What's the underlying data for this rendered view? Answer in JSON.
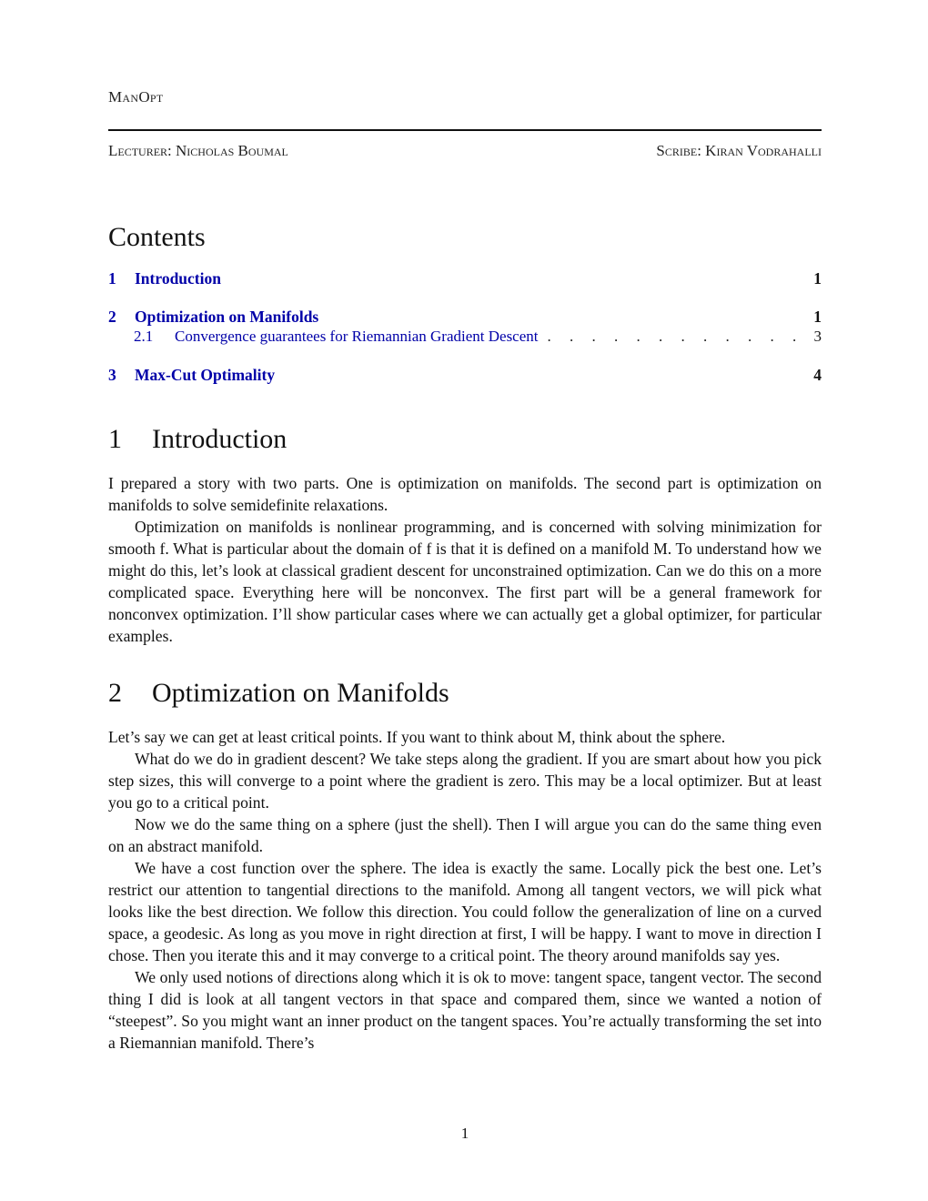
{
  "header": {
    "running_title": "ManOpt",
    "lecturer": "Lecturer: Nicholas Boumal",
    "scribe": "Scribe: Kiran Vodrahalli"
  },
  "toc": {
    "title": "Contents",
    "link_color": "#0000a8",
    "entries": [
      {
        "num": "1",
        "label": "Introduction",
        "page": "1",
        "level": 1
      },
      {
        "num": "2",
        "label": "Optimization on Manifolds",
        "page": "1",
        "level": 1
      },
      {
        "num": "2.1",
        "label": "Convergence guarantees for Riemannian Gradient Descent",
        "page": "3",
        "level": 2
      },
      {
        "num": "3",
        "label": "Max-Cut Optimality",
        "page": "4",
        "level": 1
      }
    ]
  },
  "sections": [
    {
      "num": "1",
      "title": "Introduction",
      "paragraphs": [
        "I prepared a story with two parts. One is optimization on manifolds. The second part is optimization on manifolds to solve semidefinite relaxations.",
        "Optimization on manifolds is nonlinear programming, and is concerned with solving minimization for smooth f. What is particular about the domain of f is that it is defined on a manifold M. To understand how we might do this, let’s look at classical gradient descent for unconstrained optimization. Can we do this on a more complicated space. Everything here will be nonconvex. The first part will be a general framework for nonconvex optimization. I’ll show particular cases where we can actually get a global optimizer, for particular examples."
      ]
    },
    {
      "num": "2",
      "title": "Optimization on Manifolds",
      "paragraphs": [
        "Let’s say we can get at least critical points. If you want to think about M, think about the sphere.",
        "What do we do in gradient descent? We take steps along the gradient. If you are smart about how you pick step sizes, this will converge to a point where the gradient is zero. This may be a local optimizer. But at least you go to a critical point.",
        "Now we do the same thing on a sphere (just the shell). Then I will argue you can do the same thing even on an abstract manifold.",
        "We have a cost function over the sphere. The idea is exactly the same. Locally pick the best one. Let’s restrict our attention to tangential directions to the manifold. Among all tangent vectors, we will pick what looks like the best direction. We follow this direction. You could follow the generalization of line on a curved space, a geodesic. As long as you move in right direction at first, I will be happy. I want to move in direction I chose. Then you iterate this and it may converge to a critical point. The theory around manifolds say yes.",
        "We only used notions of directions along which it is ok to move: tangent space, tangent vector. The second thing I did is look at all tangent vectors in that space and compared them, since we wanted a notion of “steepest”. So you might want an inner product on the tangent spaces. You’re actually transforming the set into a Riemannian manifold. There’s"
      ]
    }
  ],
  "footer": {
    "page_number": "1"
  }
}
